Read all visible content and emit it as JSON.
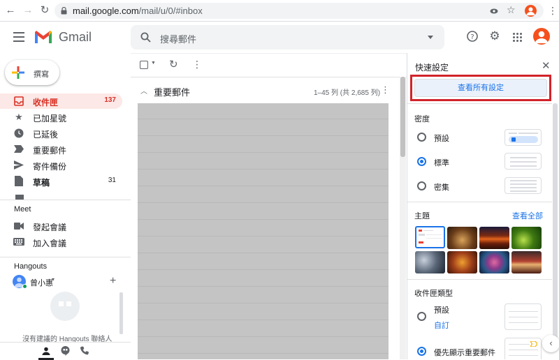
{
  "browser": {
    "url_domain": "mail.google.com",
    "url_path": "/mail/u/0/#inbox"
  },
  "header": {
    "app_name": "Gmail",
    "search_placeholder": "搜尋郵件"
  },
  "sidebar": {
    "compose_label": "撰寫",
    "items": [
      {
        "label": "收件匣",
        "count": "137",
        "icon": "inbox-icon",
        "active": true
      },
      {
        "label": "已加星號",
        "count": "",
        "icon": "star-icon"
      },
      {
        "label": "已延後",
        "count": "",
        "icon": "clock-icon"
      },
      {
        "label": "重要郵件",
        "count": "",
        "icon": "label-important-icon"
      },
      {
        "label": "寄件備份",
        "count": "",
        "icon": "send-icon"
      },
      {
        "label": "草稿",
        "count": "31",
        "icon": "draft-icon"
      }
    ],
    "meet_title": "Meet",
    "meet_items": [
      {
        "label": "發起會議",
        "icon": "video-icon"
      },
      {
        "label": "加入會議",
        "icon": "keyboard-icon"
      }
    ],
    "hangouts_title": "Hangouts",
    "hangouts_user": "曾小惠",
    "hangouts_empty": "沒有建議的 Hangouts 聯絡人"
  },
  "main": {
    "section_title": "重要郵件",
    "pagination": "1–45 列 (共 2,685 列)"
  },
  "quick_settings": {
    "title": "快速設定",
    "see_all_button": "查看所有設定",
    "density_title": "密度",
    "density_options": [
      {
        "label": "預設",
        "selected": false
      },
      {
        "label": "標準",
        "selected": true
      },
      {
        "label": "密集",
        "selected": false
      }
    ],
    "theme_title": "主題",
    "theme_view_all": "查看全部",
    "inbox_type_title": "收件匣類型",
    "inbox_options": [
      {
        "label": "預設",
        "link": "自訂",
        "selected": false
      },
      {
        "label": "優先顯示重要郵件",
        "selected": true
      }
    ]
  },
  "colors": {
    "accent": "#1a73e8",
    "active_nav": "#d93025",
    "highlight": "#d2232a"
  }
}
